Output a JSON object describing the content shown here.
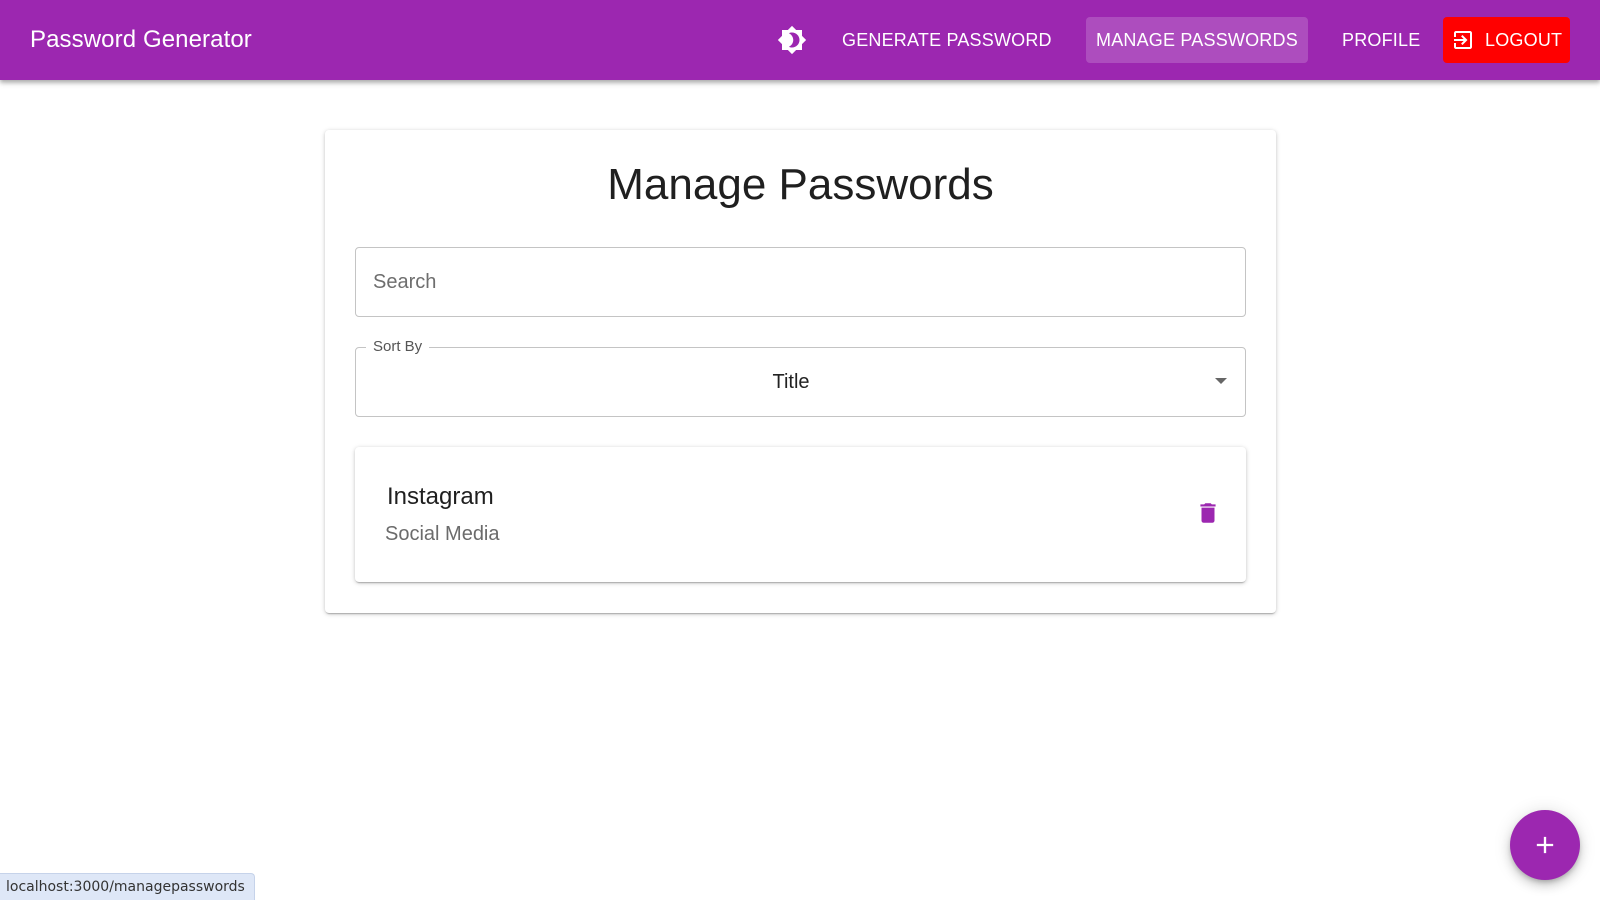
{
  "appbar": {
    "brand": "Password Generator",
    "theme_toggle_icon": "brightness-icon",
    "nav": {
      "generate": "GENERATE PASSWORD",
      "manage": "MANAGE PASSWORDS",
      "profile": "PROFILE",
      "logout": "LOGOUT"
    },
    "colors": {
      "primary": "#9c27b0",
      "logout": "#ff0000"
    }
  },
  "main": {
    "title": "Manage Passwords",
    "search": {
      "placeholder": "Search",
      "value": ""
    },
    "sort": {
      "label": "Sort By",
      "selected": "Title"
    },
    "entries": [
      {
        "title": "Instagram",
        "category": "Social Media",
        "action_icon": "trash-icon"
      }
    ]
  },
  "fab": {
    "icon": "plus-icon"
  },
  "status_bar": {
    "url": "localhost:3000/managepasswords"
  }
}
